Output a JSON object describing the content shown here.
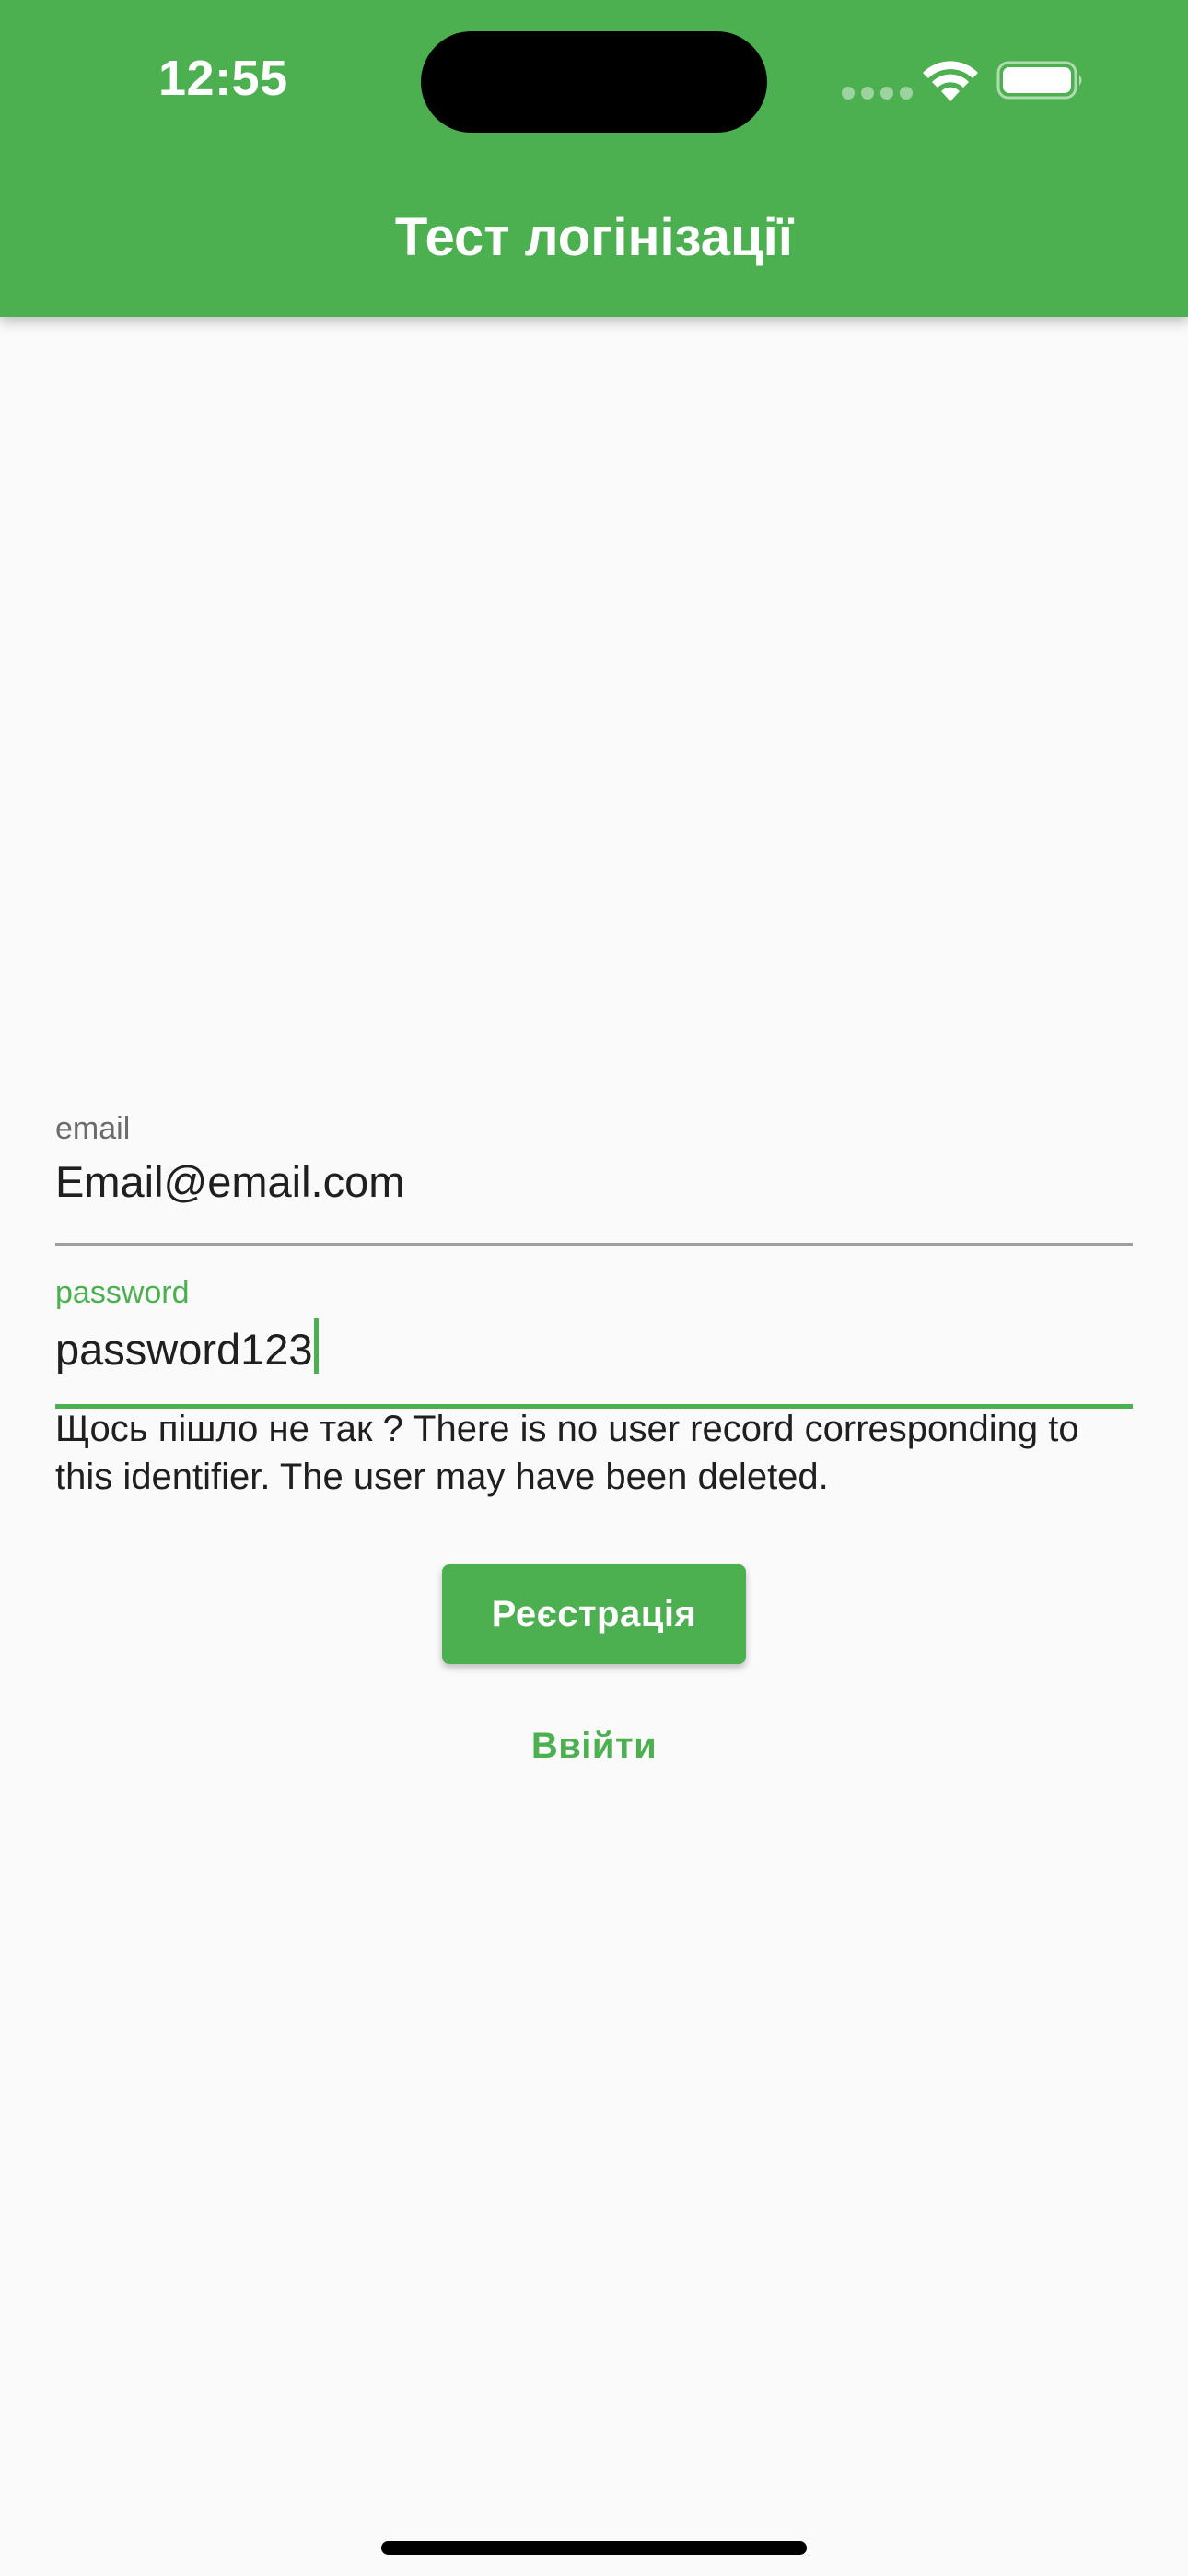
{
  "status_bar": {
    "time": "12:55"
  },
  "app_bar": {
    "title": "Тест логінізації",
    "color": "#4CAF50"
  },
  "form": {
    "email": {
      "label": "email",
      "value": "Email@email.com"
    },
    "password": {
      "label": "password",
      "value": "password123"
    },
    "error_message": "Щось пішло не так ? There is no user record corresponding to this identifier. The user may have been deleted.",
    "register_button": "Реєстрація",
    "login_button": "Ввійти"
  },
  "icons": {
    "wifi": "wifi-icon",
    "battery": "battery-icon",
    "signal": "cellular-signal-icon"
  },
  "colors": {
    "accent": "#4CAF50",
    "background": "#FAFAFA"
  }
}
